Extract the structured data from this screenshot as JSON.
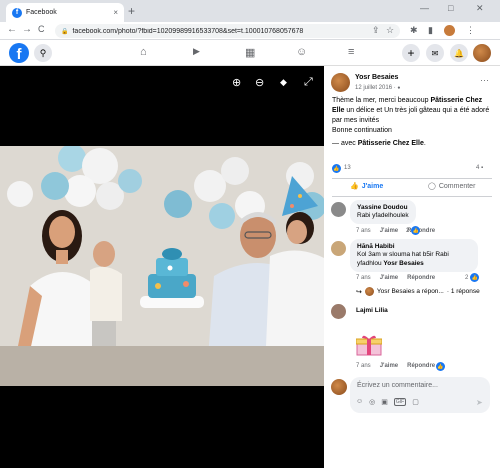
{
  "browser": {
    "tab_title": "Facebook",
    "tab_close": "×",
    "new_tab": "+",
    "win_min": "—",
    "win_max": "□",
    "win_close": "✕",
    "back": "←",
    "forward": "→",
    "reload": "C",
    "lock": "🔒",
    "url": "facebook.com/photo/?fbid=1020998991653370&set=t.100010768057678",
    "url_display_full": "facebook.com/photo/?fbid=10209989916533708&set=t.100010768057678"
  },
  "fbnav": {
    "logo": "f",
    "search_icon": "⚲",
    "home_icon": "⌂",
    "watch_icon": "▶",
    "market_icon": "▦",
    "groups_icon": "☺",
    "menu_icon": "≡",
    "create_icon": "+",
    "messenger_icon": "✉",
    "notif_icon": "🔔"
  },
  "photo_controls": {
    "zoom_in": "⊕",
    "zoom_out": "⊖",
    "tag": "◆",
    "fullscreen": "⤢"
  },
  "post": {
    "author": "Yosr Besaies",
    "date": "12 juillet 2016 · ",
    "audience_icon": "●",
    "more": "···",
    "text_1": "Thème la mer, merci beaucoup ",
    "text_1b": "Pâtisserie Chez Elle",
    "text_1c": " un délice et Un très joli gâteau qui a été adoré par mes invités",
    "text_2": "Bonne continuation",
    "with_prefix": "— avec ",
    "with_name": "Pâtisserie Chez Elle",
    "with_suffix": ".",
    "reactions_count": "13",
    "comments_count": "4",
    "like_label": "J'aime",
    "comment_label": "Commenter"
  },
  "comments": [
    {
      "name": "Yassine Doudou",
      "text": "Rabi yfadelhoulek",
      "time": "7 ans",
      "like": "J'aime",
      "reply": "Répondre",
      "likes": "2"
    },
    {
      "name": "Hānā Habibi",
      "text_1": "Kol 3am w slouma hat b5ir Rabi yfadhlou ",
      "text_bold": "Yosr Besaies",
      "time": "7 ans",
      "like": "J'aime",
      "reply": "Répondre",
      "likes": "2",
      "reply_link": "Yosr Besaies a répon...",
      "reply_count": "· 1 réponse"
    },
    {
      "name": "Lajmi Lilia",
      "time": "7 ans",
      "like": "J'aime",
      "reply": "Répondre"
    }
  ],
  "composer": {
    "placeholder": "Écrivez un commentaire...",
    "icons": [
      "☺",
      "◎",
      "▣",
      "GIF",
      "▢"
    ],
    "send": "➤"
  },
  "colors": {
    "fb_blue": "#1877f2",
    "bubble": "#f0f2f5",
    "secondary_text": "#65676b"
  }
}
